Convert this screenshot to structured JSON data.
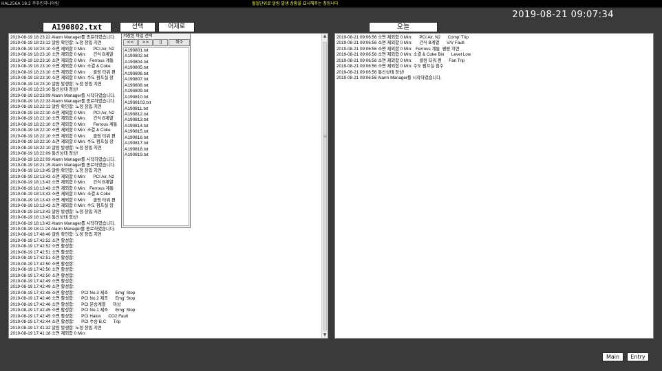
{
  "topbar": {
    "app_title": "HAL256A  18.2    주푸린지니아림",
    "marquee": "월일단위로 알림 발생 상황을 표시해주는 창입니다"
  },
  "clock": "2019-08-21 09:07:34",
  "file_title": "A190802.txt",
  "select_label": "선택",
  "yesterday_label": "어제로",
  "today_label": "오늘",
  "left_log": [
    "2019-08-19 18:23:22 Alarm Manager를 종료하였습니다.",
    "2019-08-19 18:23:12 알람 확인함: 노정 장입 지연",
    "2019-08-19 18:23:10 소면 제외함 0 Min:      PCI Air, N2",
    "2019-08-19 18:23:10 소면 제외함 0 Min:      건식 B계열",
    "2019-08-19 18:23:10 소면 제외함 0 Min:   Ferrous 계통",
    "2019-08-19 18:23:10 소면 제외함 0 Min: 소결 & Coke",
    "2019-08-19 18:23:10 소면 제외함 0 Min:      클링 타워 편",
    "2019-08-19 18:23:10 소면 제외함 0 Min: 수도 펌프실 장",
    "2019-08-19 18:23:10 알람 발생함: 노정 장입 지연",
    "2019-08-19 18:23:10 통신상태 정상!",
    "2019-08-19 18:23:09 Alarm Manager를 시작하였습니다.",
    "2019-08-19 18:22:33 Alarm Manager를 종료하였습니다.",
    "2019-08-19 18:22:12 알람 확인함: 노정 장입 지연",
    "2019-08-19 18:22:10 소면 제외함 0 Min:      PCI Air, N2",
    "2019-08-19 18:22:10 소면 제외함 0 Min:      건식 B계열",
    "2019-08-19 18:22:10 소면 제외함 0 Min:      Ferrous 계통",
    "2019-08-19 18:22:10 소면 제외함 0 Min: 소결 & Coke",
    "2019-08-19 18:22:10 소면 제외함 0 Min:      클링 타워 편",
    "2019-08-19 18:22:10 소면 제외함 0 Min: 수도 펌프실 장",
    "2019-08-19 18:22:10 알람 발생함: 노정 장입 지연",
    "2019-08-19 18:22:09 통신상태 정상!",
    "2019-08-19 18:22:09 Alarm Manager를 시작하였습니다.",
    "2019-08-19 18:21:15 Alarm Manager를 종료하였습니다.",
    "2019-08-19 18:13:45 알람 확인함: 노정 장입 지연",
    "2019-08-19 18:13:43 소면 제외함 0 Min:      PCI Air, N2",
    "2019-08-19 18:13:43 소면 제외함 0 Min:      건식 B계열",
    "2019-08-19 18:13:43 소면 제외함 0 Min:   Ferrous 계통",
    "2019-08-19 18:13:43 소면 제외함 0 Min: 소결 & Coke",
    "2019-08-19 18:13:43 소면 제외함 0 Min:      클링 타워 편",
    "2019-08-19 18:13:43 소면 제외함 0 Min: 수도 펌프실 장",
    "2019-08-19 18:13:43 알람 발생함: 노정 장입 지연",
    "2019-08-19 18:13:43 통신상태 정상!",
    "2019-08-19 18:13:43 Alarm Manager를 시작하였습니다.",
    "2019-08-19 18:11:24 Alarm Manager를 종료하였습니다.",
    "2019-08-19 17:48:46 알람 확인함: 노정 장입 지연",
    "2019-08-19 17:42:52 소면 활성함:",
    "2019-08-19 17:42:52 소면 활성함:",
    "2019-08-19 17:42:51 소면 활성함:",
    "2019-08-19 17:42:51 소면 활성함:",
    "2019-08-19 17:42:50 소면 활성함:",
    "2019-08-19 17:42:50 소면 활성함:",
    "2019-08-19 17:42:50 소면 활성함:",
    "2019-08-19 17:42:49 소면 활성함:",
    "2019-08-19 17:42:49 소면 활성함:",
    "2019-08-19 17:42:48 소면 활성함:      PCI No.3 제조      Emg' Stop",
    "2019-08-19 17:42:46 소면 활성함:      PCI No.2 제조      Emg' Stop",
    "2019-08-19 17:42:46 소면 활성함:      PCI 분송계열      미상",
    "2019-08-19 17:42:45 소면 활성함:      PCI No.1 제조      Emg' Stop",
    "2019-08-19 17:42:45 소면 활성함:      PCI Halon      CO2 Fault",
    "2019-08-19 17:42:44 소면 활성함:      PCI 수송 B,C      Trip",
    "2019-08-19 17:41:32 알람 발생함: 노정 장입 지연",
    "2019-08-19 17:41:18 소면 제외함 0 Min:"
  ],
  "right_log": [
    "2019-08-21 09:06:56 소면 제외함 0 Min:      PCI Air, N2      Comp' Trip",
    "2019-08-21 09:06:56 소면 제외함 0 Min:      건식 B계열      V/V Fault",
    "2019-08-21 09:06:56 소면 제외함 0 Min:   Ferrous 계통  평량 지연",
    "2019-08-21 09:06:56 소면 제외함 0 Min: 소결 & Coke Bin      Level Low",
    "2019-08-21 09:06:56 소면 제외함 0 Min:      클링 타워 편      Fan Trip",
    "2019-08-21 09:06:56 소면 제외함 0 Min: 수도 펌프실 침수",
    "2019-08-21 09:06:56 통신상태 정상!",
    "2019-08-21 09:06:56 Alarm Manager를 시작하였습니다."
  ],
  "file_popup": {
    "title": "저장된 파일 선택",
    "prev_label": "<<",
    "next_label": ">>",
    "pause_label": "||",
    "cancel_label": "취소",
    "files": [
      "A190801.txt",
      "A190802.txt",
      "A190804.txt",
      "A190805.txt",
      "A190806.txt",
      "A190807.txt",
      "A190808.txt",
      "A190809.txt",
      "A190810.txt",
      "A1908103.txt",
      "A190811.txt",
      "A190812.txt",
      "A190813.txt",
      "A190814.txt",
      "A190815.txt",
      "A190816.txt",
      "A190817.txt",
      "A190818.txt",
      "A190819.txt"
    ]
  },
  "bottom": {
    "main_label": "Main",
    "entry_label": "Entry"
  },
  "colors": {
    "background": "#3a3a3a",
    "panel": "#ffffff",
    "topbar": "#000000",
    "marquee": "#ffff66"
  }
}
